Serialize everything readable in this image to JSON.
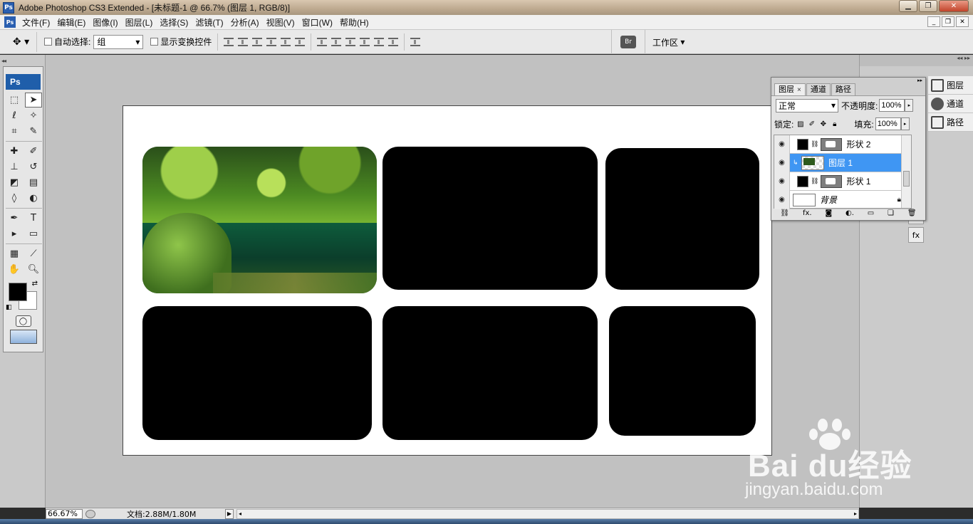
{
  "window": {
    "title": "Adobe Photoshop CS3 Extended - [未标题-1 @ 66.7% (图层 1, RGB/8)]",
    "logo": "Ps"
  },
  "menu": [
    "文件(F)",
    "编辑(E)",
    "图像(I)",
    "图层(L)",
    "选择(S)",
    "滤镜(T)",
    "分析(A)",
    "视图(V)",
    "窗口(W)",
    "帮助(H)"
  ],
  "options": {
    "auto_select_label": "自动选择:",
    "auto_select_value": "组",
    "show_transform_label": "显示变换控件",
    "workspace_label": "工作区"
  },
  "toolbox": {
    "badge": "Ps",
    "text_tool": "T"
  },
  "layers_panel": {
    "tabs": [
      "图层",
      "通道",
      "路径"
    ],
    "blend_mode": "正常",
    "opacity_label": "不透明度:",
    "opacity_value": "100%",
    "lock_label": "锁定:",
    "fill_label": "填充:",
    "fill_value": "100%",
    "layers": [
      {
        "name": "形状 2",
        "selected": false
      },
      {
        "name": "图层 1",
        "selected": true
      },
      {
        "name": "形状 1",
        "selected": false
      },
      {
        "name": "背景",
        "selected": false
      }
    ]
  },
  "right_dock": [
    "图层",
    "通道",
    "路径"
  ],
  "status": {
    "zoom": "66.67%",
    "doc_info": "文档:2.88M/1.80M"
  },
  "watermark": {
    "brand": "Bai du经验",
    "url": "jingyan.baidu.com"
  },
  "colors": {
    "selection": "#3f96f3",
    "shape_fill": "#000000",
    "workspace_bg": "#c1c1c1"
  }
}
